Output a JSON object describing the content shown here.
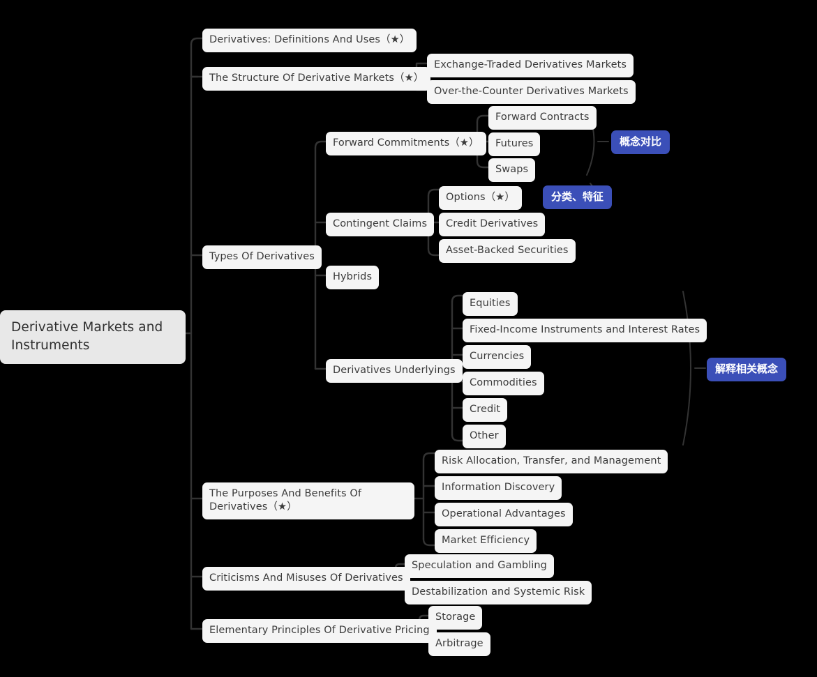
{
  "diagram": {
    "type": "mindmap",
    "background_color": "#000000",
    "node_color": "#f5f5f5",
    "root_color": "#e8e8e8",
    "text_color": "#3b3b3b",
    "badge_color": "#3b4fb8",
    "edge_color": "#333333"
  },
  "root": {
    "label": "Derivative Markets and Instruments"
  },
  "branches": [
    {
      "id": "b1",
      "label": "Derivatives: Definitions And Uses（★）",
      "children": []
    },
    {
      "id": "b2",
      "label": "The Structure Of Derivative Markets（★）",
      "children": [
        {
          "label": "Exchange-Traded Derivatives Markets"
        },
        {
          "label": "Over-the-Counter Derivatives Markets"
        }
      ]
    },
    {
      "id": "b3",
      "label": "Types Of Derivatives",
      "children": [
        {
          "label": "Forward Commitments（★）",
          "children": [
            {
              "label": "Forward Contracts"
            },
            {
              "label": "Futures"
            },
            {
              "label": "Swaps"
            }
          ],
          "summary_badge": "概念对比"
        },
        {
          "label": "Contingent Claims",
          "children": [
            {
              "label": "Options（★）",
              "summary_badge": "分类、特征"
            },
            {
              "label": "Credit Derivatives"
            },
            {
              "label": "Asset-Backed Securities"
            }
          ]
        },
        {
          "label": "Hybrids",
          "children": []
        },
        {
          "label": "Derivatives Underlyings",
          "children": [
            {
              "label": "Equities"
            },
            {
              "label": "Fixed-Income Instruments and Interest Rates"
            },
            {
              "label": "Currencies"
            },
            {
              "label": "Commodities"
            },
            {
              "label": "Credit"
            },
            {
              "label": "Other"
            }
          ],
          "summary_badge": "解释相关概念"
        }
      ]
    },
    {
      "id": "b4",
      "label": "The Purposes And Benefits Of Derivatives（★）",
      "children": [
        {
          "label": "Risk Allocation, Transfer, and Management"
        },
        {
          "label": "Information Discovery"
        },
        {
          "label": "Operational Advantages"
        },
        {
          "label": "Market Efficiency"
        }
      ]
    },
    {
      "id": "b5",
      "label": "Criticisms And Misuses Of Derivatives",
      "children": [
        {
          "label": "Speculation and Gambling"
        },
        {
          "label": "Destabilization and Systemic Risk"
        }
      ]
    },
    {
      "id": "b6",
      "label": "Elementary Principles Of Derivative Pricing",
      "children": [
        {
          "label": "Storage"
        },
        {
          "label": "Arbitrage"
        }
      ]
    }
  ],
  "badges": [
    {
      "id": "badge-forward-commitments",
      "label": "概念对比"
    },
    {
      "id": "badge-options",
      "label": "分类、特征"
    },
    {
      "id": "badge-underlyings",
      "label": "解释相关概念"
    }
  ],
  "nodes_flat": {
    "root": "Derivative Markets and Instruments",
    "n_defs": "Derivatives: Definitions And Uses（★）",
    "n_structure": "The Structure Of Derivative Markets（★）",
    "n_exchange": "Exchange-Traded Derivatives Markets",
    "n_otc": "Over-the-Counter Derivatives Markets",
    "n_types": "Types Of Derivatives",
    "n_forward_commitments": "Forward Commitments（★）",
    "n_forward_contracts": "Forward Contracts",
    "n_futures": "Futures",
    "n_swaps": "Swaps",
    "n_contingent": "Contingent Claims",
    "n_options": "Options（★）",
    "n_credit_deriv": "Credit Derivatives",
    "n_abs": "Asset-Backed Securities",
    "n_hybrids": "Hybrids",
    "n_underlyings": "Derivatives Underlyings",
    "n_equities": "Equities",
    "n_fixed_income": "Fixed-Income Instruments and Interest Rates",
    "n_currencies": "Currencies",
    "n_commodities": "Commodities",
    "n_credit": "Credit",
    "n_other": "Other",
    "n_purposes": "The Purposes And Benefits Of Derivatives（★）",
    "n_risk_alloc": "Risk Allocation, Transfer, and Management",
    "n_info_disc": "Information Discovery",
    "n_oper_adv": "Operational Advantages",
    "n_market_eff": "Market Efficiency",
    "n_criticisms": "Criticisms And Misuses Of Derivatives",
    "n_speculation": "Speculation and Gambling",
    "n_destabilization": "Destabilization and Systemic Risk",
    "n_elementary": "Elementary Principles Of Derivative Pricing",
    "n_storage": "Storage",
    "n_arbitrage": "Arbitrage",
    "badge_concept_compare": "概念对比",
    "badge_classify": "分类、特征",
    "badge_explain": "解释相关概念"
  }
}
